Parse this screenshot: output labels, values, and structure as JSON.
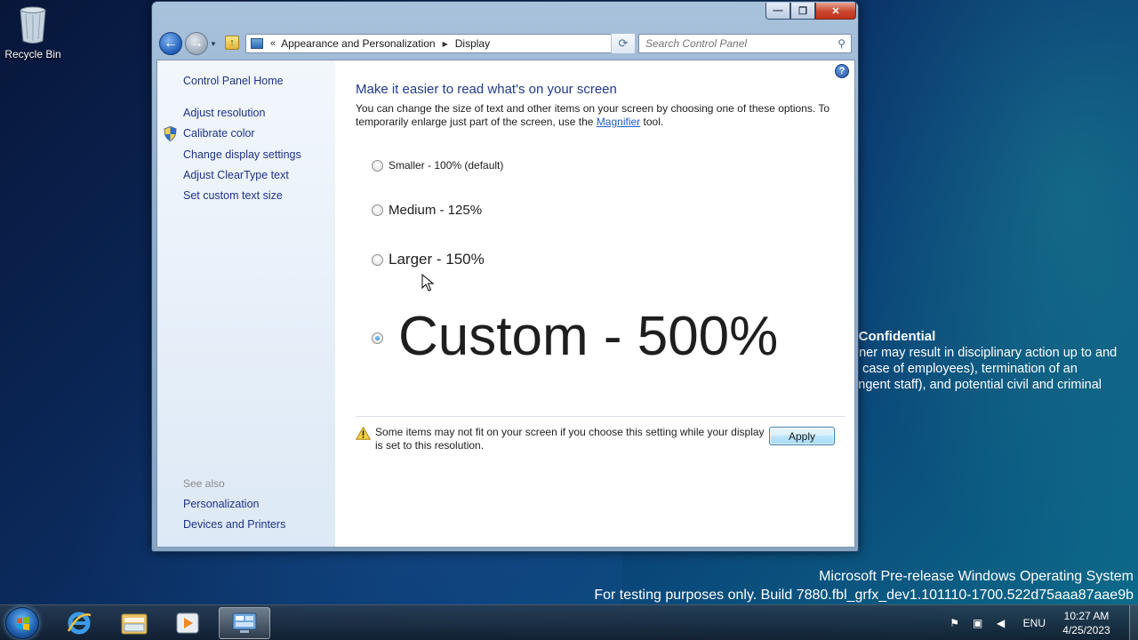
{
  "desktop": {
    "recycle_bin_label": "Recycle Bin",
    "confidential": {
      "title": "Confidential",
      "lines": [
        "nner may result in disciplinary action up to and",
        "e case of employees), termination of an",
        "tingent staff), and potential civil and criminal"
      ],
      "title_prefix": ":"
    },
    "build_watermark": {
      "line1": "Microsoft Pre-release Windows Operating System",
      "line2": "For testing purposes only. Build 7880.fbl_grfx_dev1.101110-1700.522d75aaa87aae9b"
    }
  },
  "window": {
    "controls": {
      "minimize": "—",
      "maximize": "❐",
      "close": "✕"
    },
    "address": {
      "chevron": "«",
      "crumb1": "Appearance and Personalization",
      "separator": "▶",
      "crumb2": "Display"
    },
    "search": {
      "placeholder": "Search Control Panel"
    },
    "left_pane": {
      "home": "Control Panel Home",
      "links": [
        "Adjust resolution",
        "Calibrate color",
        "Change display settings",
        "Adjust ClearType text",
        "Set custom text size"
      ],
      "see_also_label": "See also",
      "see_also": [
        "Personalization",
        "Devices and Printers"
      ]
    },
    "main": {
      "title": "Make it easier to read what's on your screen",
      "desc_before": "You can change the size of text and other items on your screen by choosing one of these options. To temporarily enlarge just part of the screen, use the ",
      "desc_link": "Magnifier",
      "desc_after": " tool.",
      "options": [
        {
          "label": "Smaller - 100% (default)",
          "checked": false
        },
        {
          "label": "Medium - 125%",
          "checked": false
        },
        {
          "label": "Larger - 150%",
          "checked": false
        },
        {
          "label": "Custom - 500%",
          "checked": true
        }
      ],
      "warning": "Some items may not fit on your screen if you choose this setting while your display is set to this resolution.",
      "apply_label": "Apply",
      "help": "?"
    }
  },
  "taskbar": {
    "language": "ENU",
    "time": "10:27 AM",
    "date": "4/25/2023"
  },
  "colors": {
    "link": "#1e3287",
    "title": "#1e3b8b",
    "accent": "#1f5fc7"
  }
}
